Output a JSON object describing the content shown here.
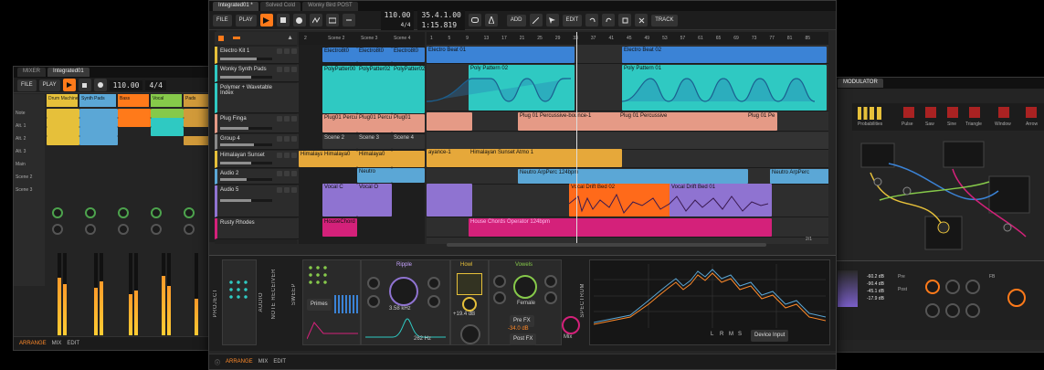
{
  "colors": {
    "accent": "#ff7a1a",
    "teal": "#2fc9c2",
    "blue": "#5ba7d6",
    "purple": "#8f73d1",
    "salmon": "#e59a86",
    "yellow": "#e6c03a",
    "magenta": "#d4217a",
    "orange_clip": "#ff6a1a",
    "green": "#86c94a"
  },
  "left_window": {
    "tabs": [
      "MIXER",
      "Integrated01"
    ],
    "toolbar": {
      "file": "FILE",
      "play": "PLAY",
      "tempo": "110.00",
      "time_sig": "4/4"
    },
    "mixer_channels": [
      "Drum Machine",
      "Synth Pads",
      "Bass",
      "Vocal",
      "Pads"
    ],
    "track_names": [
      "Note",
      "Alt. 1",
      "Alt. 2",
      "Alt. 3",
      "Main",
      "Scene 2",
      "Scene 3"
    ],
    "bottom": {
      "arrange": "ARRANGE",
      "mix": "MIX",
      "edit": "EDIT"
    }
  },
  "right_window": {
    "tabs": [
      "MODULATOR"
    ],
    "labels": [
      "Probabilities",
      "Pulse",
      "Saw",
      "Sine",
      "Triangle",
      "Window",
      "Arrow"
    ],
    "readouts": [
      "-60.2 dB",
      "-90.4 dB",
      "-45.1 dB",
      "-17.9 dB"
    ],
    "small_labels": [
      "Pre",
      "Post",
      "FB"
    ]
  },
  "main_window": {
    "tabs": [
      "Integrated01 *",
      "Solved Cold",
      "Wonky Bird POST"
    ],
    "toolbar": {
      "file": "FILE",
      "play": "PLAY",
      "tempo": "110.00",
      "time_sig": "4/4",
      "position": "35.4.1.00",
      "time": "1:15.819",
      "add": "ADD",
      "edit": "EDIT",
      "track": "TRACK"
    },
    "tracks": [
      {
        "name": "Electro Kit 1"
      },
      {
        "name": "Wonky Synth Pads"
      },
      {
        "name": "Polymer + Wavetable Index"
      },
      {
        "name": "Plug Finga"
      },
      {
        "name": "Group 4"
      },
      {
        "name": "Himalayan Sunset"
      },
      {
        "name": "Audio 2"
      },
      {
        "name": "Audio 5"
      },
      {
        "name": "Rusty Rhodes"
      }
    ],
    "scenes": [
      "2",
      "Scene 2",
      "Scene 3",
      "Scene 4",
      "Scene 5"
    ],
    "clip_launcher": {
      "row1": [
        "Electro8t0",
        "Electro8t0",
        "Electro8t0"
      ],
      "row2": [
        "PolyPatter00",
        "PolyPatter02",
        "PolyPatter02"
      ],
      "row4": [
        "Plug01 Percu",
        "Plug01 Percu",
        "Plug01"
      ],
      "row5": [
        "Scene 2",
        "Scene 3",
        "Scene 4"
      ],
      "row6": [
        "Himalaya0",
        "Himalaya0",
        "Himalaya0"
      ],
      "row7": [
        "Neutro"
      ],
      "row8": [
        "Vocal C",
        "Vocal O"
      ],
      "row9": [
        "HouseChord"
      ]
    },
    "ruler_marks": [
      "1",
      "5",
      "9",
      "13",
      "17",
      "21",
      "25",
      "29",
      "33",
      "37",
      "41",
      "45",
      "49",
      "53",
      "57",
      "61",
      "65",
      "69",
      "73",
      "77",
      "81",
      "85"
    ],
    "arranger_clips": {
      "electro1": "Electro Beat 01",
      "electro2": "Electro Beat 02",
      "poly1": "Poly Pattern 02",
      "poly2": "Poly Pattern 01",
      "plug1": "Plug 01 Percussive-bounce-1",
      "plug2": "Plug 01 Percussive",
      "plug3": "Plug 01 Pe",
      "hima1": "Himalayan Sunset Atmo 1",
      "hima0": "ayance-1",
      "neutro1": "Neutro ArpPerc 124bpm",
      "neutro2": "Neutro ArpPerc",
      "vocal1": "Vocal Drift Bed 02",
      "vocal2": "Vocal Drift Bed 01",
      "house": "House Chords Operator 124bpm"
    },
    "zoom": "2/1",
    "devices": {
      "project": "PROJECT",
      "audio": "AUDIO",
      "note_receiver": "NOTE RECEIVER",
      "sweep": "SWEEP",
      "primes": "Primes",
      "ripple": "Ripple",
      "ripple_freq": "3.58 kHz",
      "howl": "Howl",
      "howl_val": "+19.4 dB",
      "vowels": "Vowels",
      "female": "Female",
      "freq2": "262 Hz",
      "pre_fx": "Pre FX",
      "post_fx": "Post FX",
      "post_val": "-34.0 dB",
      "mix": "Mix",
      "spectrum": "SPECTRUM",
      "device_input": "Device Input",
      "lrms": [
        "L",
        "R",
        "M",
        "S"
      ]
    },
    "bottom": {
      "arrange": "ARRANGE",
      "mix": "MIX",
      "edit": "EDIT"
    }
  }
}
